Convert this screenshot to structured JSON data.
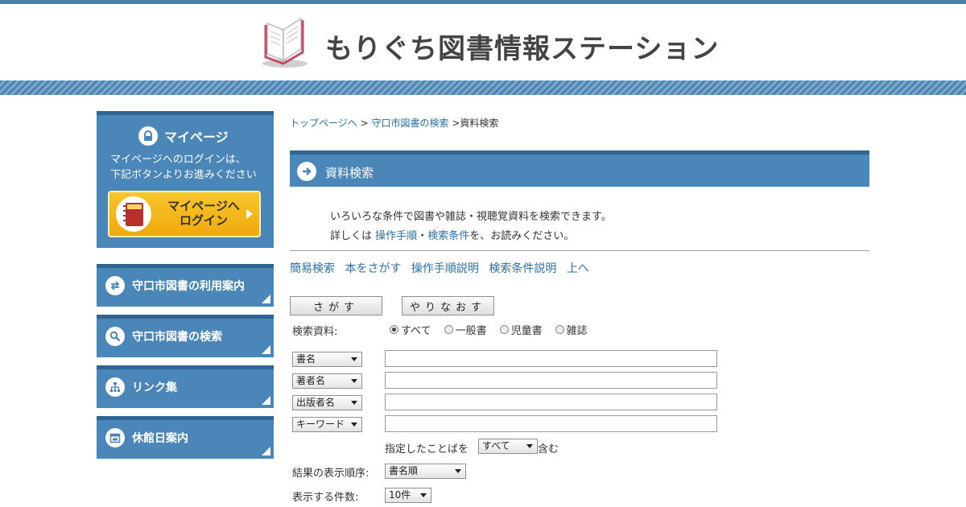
{
  "header": {
    "site_title": "もりぐち図書情報ステーション"
  },
  "sidebar": {
    "mypage": {
      "title": "マイページ",
      "desc_line1": "マイページへのログインは、",
      "desc_line2": "下記ボタンよりお進みください",
      "login_line1": "マイページへ",
      "login_line2": "ログイン"
    },
    "items": [
      {
        "label": "守口市図書の利用案内",
        "icon": "arrows-icon"
      },
      {
        "label": "守口市図書の検索",
        "icon": "search-icon"
      },
      {
        "label": "リンク集",
        "icon": "sitemap-icon"
      },
      {
        "label": "休館日案内",
        "icon": "calendar-icon"
      }
    ]
  },
  "breadcrumb": {
    "top": "トップページへ",
    "sep": ">",
    "search": "守口市図書の検索",
    "current": "資料検索"
  },
  "section": {
    "title": "資料検索"
  },
  "intro": {
    "line1": "いろいろな条件で図書や雑誌・視聴覚資料を検索できます。",
    "line2_pre": "詳しくは",
    "link1": "操作手順",
    "dot": "・",
    "link2": "検索条件",
    "line2_post": "を、お読みください。"
  },
  "quick_links": [
    "簡易検索",
    "本をさがす",
    "操作手順説明",
    "検索条件説明",
    "上へ"
  ],
  "form": {
    "search_button": "さがす",
    "reset_button": "やりなおす",
    "material_label": "検索資料:",
    "material_options": [
      "すべて",
      "一般書",
      "児童書",
      "雑誌"
    ],
    "material_selected": "すべて",
    "field_selects": [
      "書名",
      "著者名",
      "出版者名",
      "キーワード"
    ],
    "match_pre": "指定したことばを",
    "match_value": "すべて",
    "match_post": "含む",
    "sort_label": "結果の表示順序:",
    "sort_value": "書名順",
    "count_label": "表示する件数:",
    "count_value": "10件"
  },
  "colors": {
    "accent": "#4a86b7",
    "accent_dark": "#2f6592",
    "link": "#2a6fa5",
    "login_yellow": "#f2b416"
  }
}
